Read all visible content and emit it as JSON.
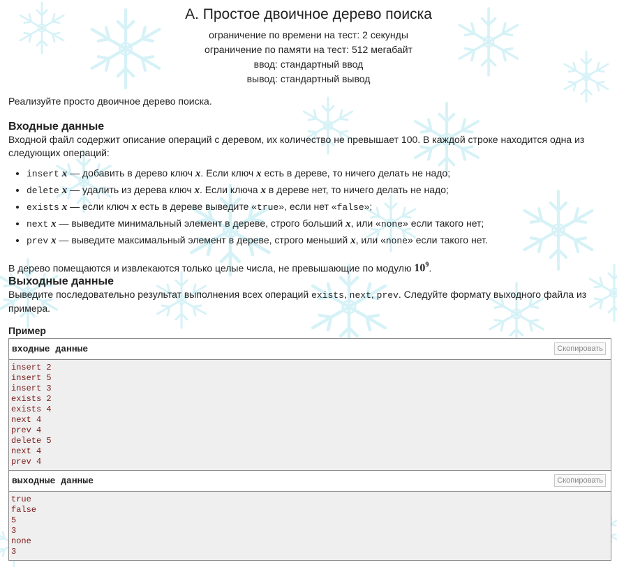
{
  "problem": {
    "title": "A. Простое двоичное дерево поиска",
    "time_limit": "ограничение по времени на тест: 2 секунды",
    "memory_limit": "ограничение по памяти на тест: 512 мегабайт",
    "input_file": "ввод: стандартный ввод",
    "output_file": "вывод: стандартный вывод"
  },
  "statement": {
    "legend": "Реализуйте просто двоичное дерево поиска.",
    "input_title": "Входные данные",
    "input_text": "Входной файл содержит описание операций с деревом, их количество не превышает 100. В каждой строке находится одна из следующих операций:",
    "ops": [
      {
        "cmd": "insert",
        "var": "x",
        "t1": " — добавить в дерево ключ ",
        "v1": "x",
        "t2": ". Если ключ ",
        "v2": "x",
        "t3": " есть в дереве, то ничего делать не надо;"
      },
      {
        "cmd": "delete",
        "var": "x",
        "t1": " — удалить из дерева ключ ",
        "v1": "x",
        "t2": ". Если ключа ",
        "v2": "x",
        "t3": " в дереве нет, то ничего делать не надо;"
      },
      {
        "cmd": "exists",
        "var": "x",
        "t1": " — если ключ ",
        "v1": "x",
        "t2": " есть в дереве выведите «",
        "m1": "true",
        "t3": "», если нет «",
        "m2": "false",
        "t4": "»;"
      },
      {
        "cmd": "next",
        "var": "x",
        "t1": " — выведите минимальный элемент в дереве, строго больший ",
        "v1": "x",
        "t2": ", или «",
        "m1": "none",
        "t3": "» если такого нет;"
      },
      {
        "cmd": "prev",
        "var": "x",
        "t1": " — выведите максимальный элемент в дереве, строго меньший ",
        "v1": "x",
        "t2": ", или «",
        "m1": "none",
        "t3": "» если такого нет."
      }
    ],
    "range_text": "В дерево помещаются и извлекаются только целые числа, не превышающие по модулю ",
    "range_base": "10",
    "range_exp": "9",
    "range_end": ".",
    "output_title": "Выходные данные",
    "output_text_1": "Выведите последовательно результат выполнения всех операций ",
    "output_cmd_1": "exists",
    "output_sep_1": ", ",
    "output_cmd_2": "next",
    "output_sep_2": ", ",
    "output_cmd_3": "prev",
    "output_text_2": ". Следуйте формату выходного файла из примера."
  },
  "example": {
    "title": "Пример",
    "input_label": "входные данные",
    "output_label": "выходные данные",
    "copy_label": "Скопировать",
    "input_lines": [
      "insert 2",
      "insert 5",
      "insert 3",
      "exists 2",
      "exists 4",
      "next 4",
      "prev 4",
      "delete 5",
      "next 4",
      "prev 4"
    ],
    "output_lines": [
      "true",
      "false",
      "5",
      "3",
      "none",
      "3"
    ]
  }
}
